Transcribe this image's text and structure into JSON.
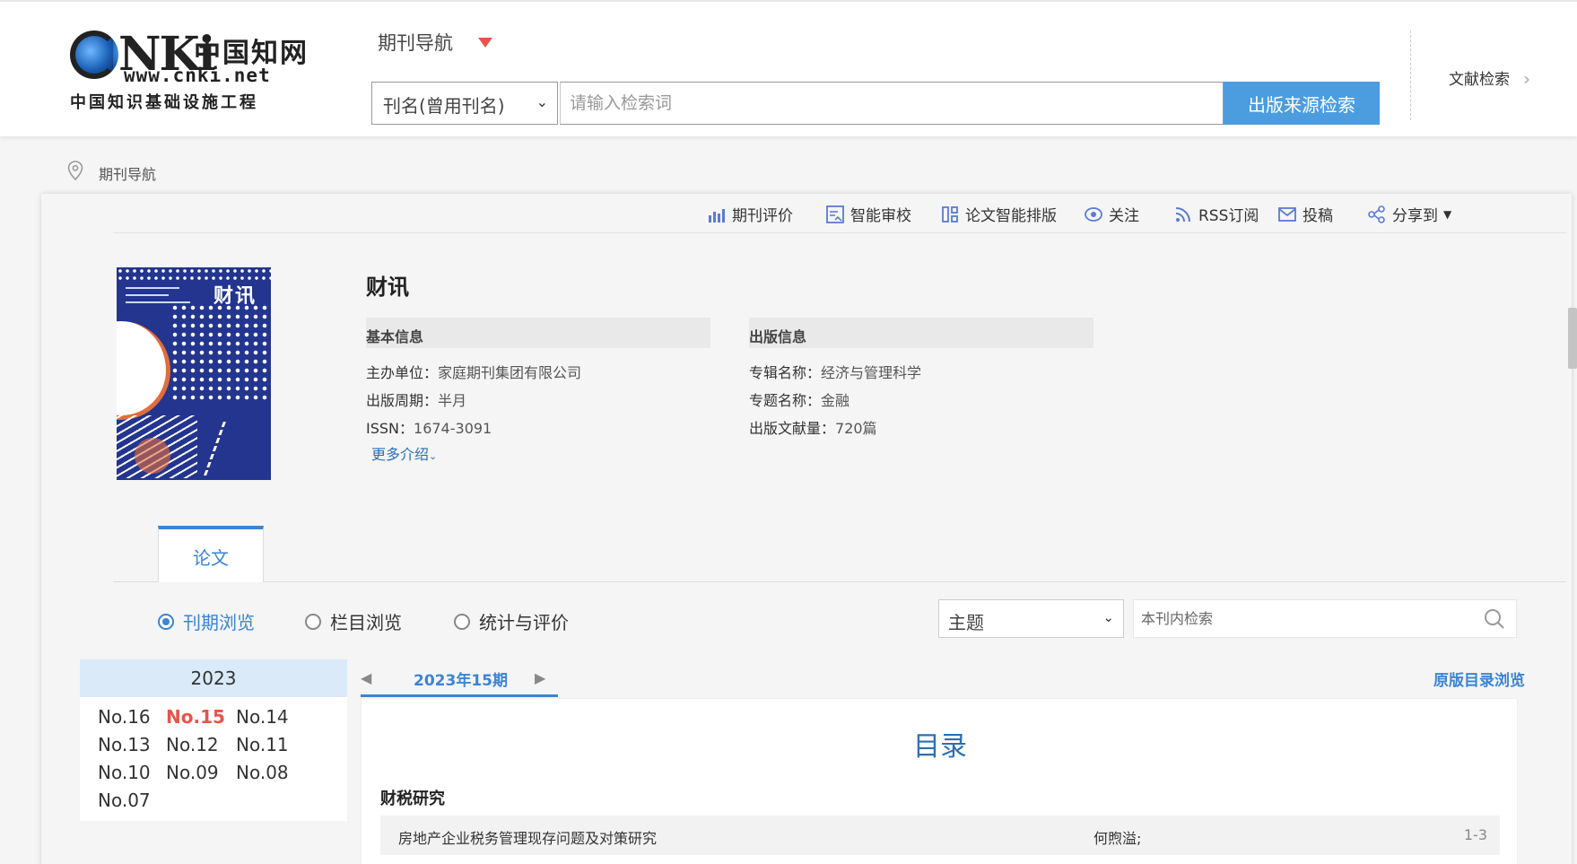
{
  "header": {
    "logo_main": "NKi",
    "logo_cn": "中国知网",
    "logo_url": "www.cnki.net",
    "logo_sub": "中国知识基础设施工程",
    "nav_title": "期刊导航",
    "search_field": "刊名(曾用刊名)",
    "search_placeholder": "请输入检索词",
    "search_button": "出版来源检索",
    "literature_search": "文献检索"
  },
  "breadcrumb": "期刊导航",
  "toolbar": {
    "evaluate": "期刊评价",
    "review": "智能审校",
    "layout": "论文智能排版",
    "follow": "关注",
    "rss": "RSS订阅",
    "submit": "投稿",
    "share": "分享到"
  },
  "journal": {
    "cover_title": "财讯",
    "title": "财讯",
    "basic_head": "基本信息",
    "publish_head": "出版信息",
    "sponsor_label": "主办单位：",
    "sponsor": "家庭期刊集团有限公司",
    "period_label": "出版周期：",
    "period": "半月",
    "issn_label": "ISSN：",
    "issn": "1674-3091",
    "series_label": "专辑名称：",
    "series": "经济与管理科学",
    "topic_label": "专题名称：",
    "topic": "金融",
    "count_label": "出版文献量：",
    "count": "720篇",
    "more": "更多介绍"
  },
  "tabs": {
    "paper": "论文"
  },
  "browse": {
    "by_issue": "刊期浏览",
    "by_column": "栏目浏览",
    "by_stats": "统计与评价",
    "field": "主题",
    "search_placeholder": "本刊内检索"
  },
  "years": {
    "year": "2023",
    "issues": [
      "No.16",
      "No.15",
      "No.14",
      "No.13",
      "No.12",
      "No.11",
      "No.10",
      "No.09",
      "No.08",
      "No.07"
    ],
    "active": "No.15"
  },
  "issue": {
    "label": "2023年15期",
    "orig_link": "原版目录浏览",
    "toc_title": "目录",
    "section": "财税研究",
    "articles": [
      {
        "title": "房地产企业税务管理现存问题及对策研究",
        "author": "何煦溢;",
        "pages": "1-3"
      }
    ]
  },
  "colors": {
    "accent": "#3b84d6",
    "search_button": "#4b9de0",
    "active_issue": "#e8534b"
  }
}
